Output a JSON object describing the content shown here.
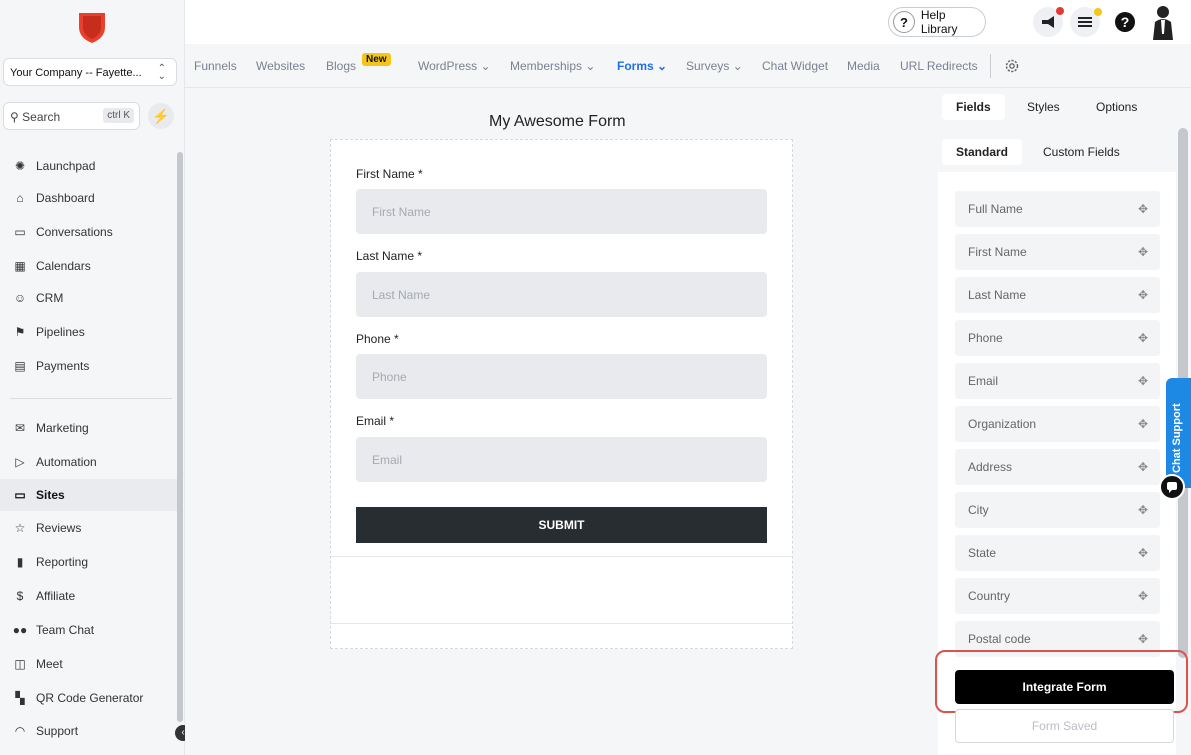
{
  "sidebar": {
    "company": "Your Company -- Fayette...",
    "search_label": "Search",
    "search_shortcut": "ctrl K",
    "items": [
      {
        "label": "Launchpad",
        "icon": "launchpad-icon"
      },
      {
        "label": "Dashboard",
        "icon": "home-icon"
      },
      {
        "label": "Conversations",
        "icon": "chat-icon"
      },
      {
        "label": "Calendars",
        "icon": "calendar-icon"
      },
      {
        "label": "CRM",
        "icon": "users-icon"
      },
      {
        "label": "Pipelines",
        "icon": "flag-icon"
      },
      {
        "label": "Payments",
        "icon": "card-icon"
      },
      {
        "label": "Marketing",
        "icon": "mail-icon"
      },
      {
        "label": "Automation",
        "icon": "play-icon"
      },
      {
        "label": "Sites",
        "icon": "monitor-icon",
        "active": true
      },
      {
        "label": "Reviews",
        "icon": "star-icon"
      },
      {
        "label": "Reporting",
        "icon": "bar-chart-icon"
      },
      {
        "label": "Affiliate",
        "icon": "dollar-icon"
      },
      {
        "label": "Team Chat",
        "icon": "team-icon"
      },
      {
        "label": "Meet",
        "icon": "cast-icon"
      },
      {
        "label": "QR Code Generator",
        "icon": "qr-icon"
      },
      {
        "label": "Support",
        "icon": "headset-icon"
      }
    ]
  },
  "topbar": {
    "help_label": "Help Library",
    "help_icon": "question-icon",
    "notification_dot_color": "#e53935",
    "tasks_dot_color": "#f5c518"
  },
  "tabs": {
    "items": [
      {
        "label": "Funnels"
      },
      {
        "label": "Websites"
      },
      {
        "label": "Blogs",
        "badge": "New"
      },
      {
        "label": "WordPress ⌄"
      },
      {
        "label": "Memberships ⌄"
      },
      {
        "label": "Forms ⌄",
        "active": true
      },
      {
        "label": "Surveys ⌄"
      },
      {
        "label": "Chat Widget"
      },
      {
        "label": "Media"
      },
      {
        "label": "URL Redirects"
      }
    ],
    "settings_icon": "gear-icon",
    "accent": "#1f6feb"
  },
  "form": {
    "title": "My Awesome Form",
    "fields": [
      {
        "label": "First Name *",
        "placeholder": "First Name"
      },
      {
        "label": "Last Name *",
        "placeholder": "Last Name"
      },
      {
        "label": "Phone *",
        "placeholder": "Phone"
      },
      {
        "label": "Email *",
        "placeholder": "Email"
      }
    ],
    "submit_label": "SUBMIT"
  },
  "panel": {
    "tabs": [
      "Fields",
      "Styles",
      "Options"
    ],
    "subtabs": [
      "Standard",
      "Custom Fields"
    ],
    "fields": [
      "Full Name",
      "First Name",
      "Last Name",
      "Phone",
      "Email",
      "Organization",
      "Address",
      "City",
      "State",
      "Country",
      "Postal code"
    ],
    "integrate_label": "Integrate Form",
    "saved_label": "Form Saved",
    "chat_support_label": "Chat Support",
    "highlight_color": "#d9534f"
  }
}
